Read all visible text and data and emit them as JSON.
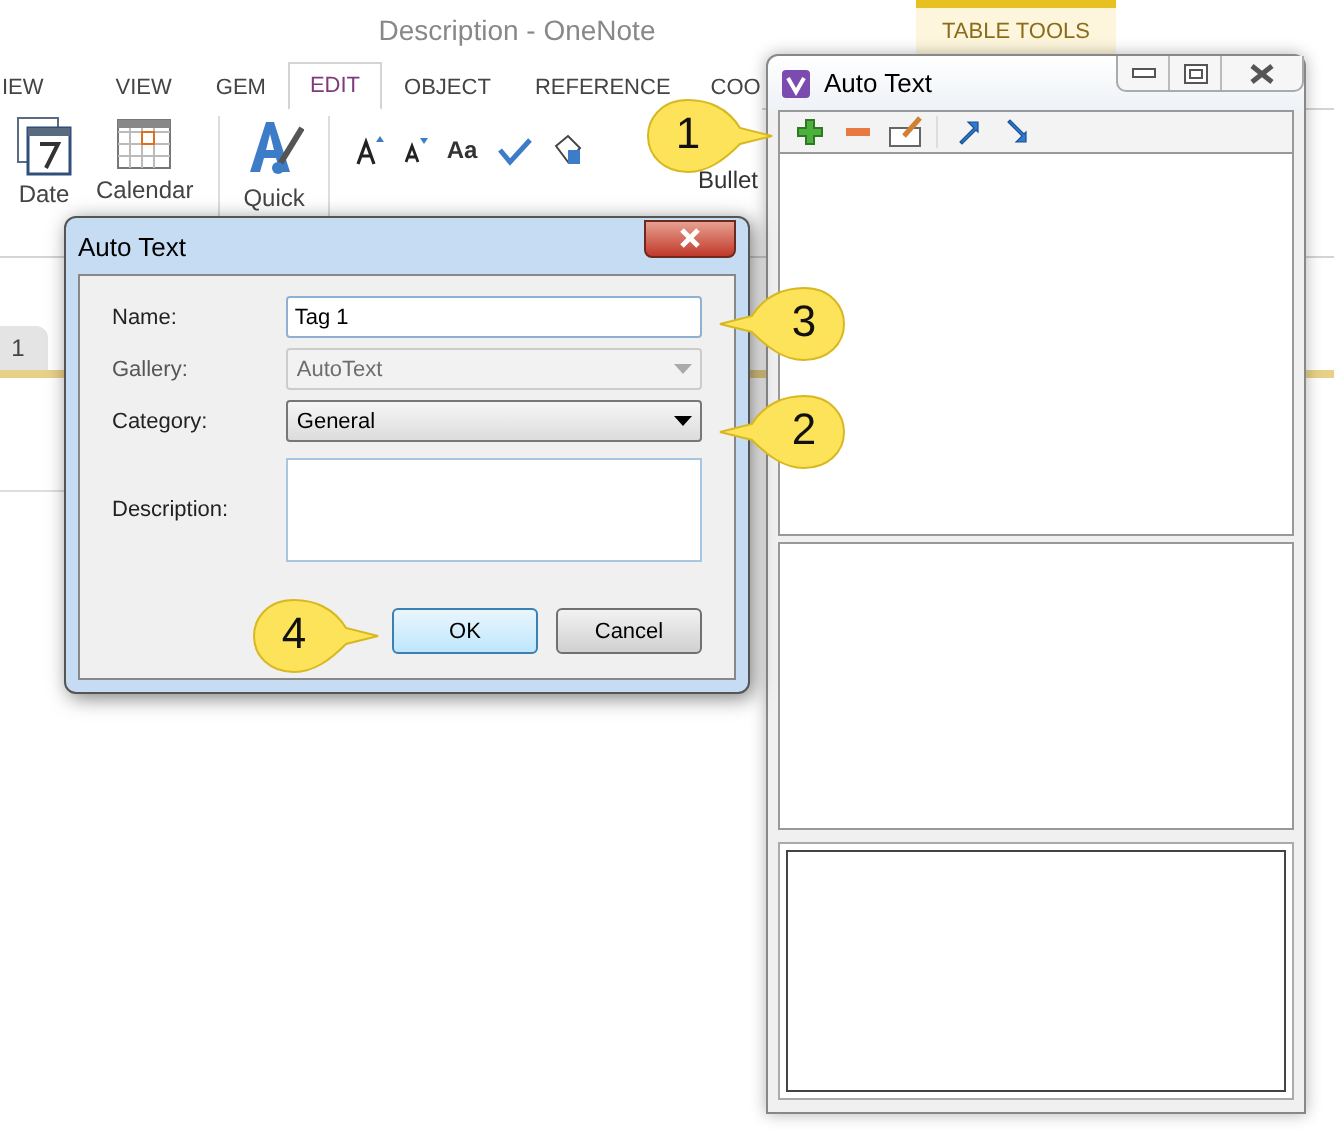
{
  "app": {
    "title": "Description - OneNote",
    "context_tab": "TABLE TOOLS",
    "tabs": [
      {
        "label": "IEW",
        "selected": false
      },
      {
        "label": "VIEW",
        "selected": false
      },
      {
        "label": "GEM",
        "selected": false
      },
      {
        "label": "EDIT",
        "selected": true
      },
      {
        "label": "OBJECT",
        "selected": false
      },
      {
        "label": "REFERENCE",
        "selected": false
      },
      {
        "label": "COO",
        "selected": false
      }
    ],
    "ribbon": [
      {
        "kind": "date",
        "label": "Date"
      },
      {
        "kind": "calendar",
        "label": "Calendar"
      },
      {
        "kind": "quick",
        "label": "Quick"
      }
    ],
    "font_case": "Aa",
    "bullet": "Bullet",
    "section_tab": "1"
  },
  "panel": {
    "title": "Auto Text"
  },
  "dialog": {
    "title": "Auto Text",
    "fields": [
      {
        "kind": "text",
        "label": "Name:",
        "value": "Tag 1"
      },
      {
        "kind": "select",
        "label": "Gallery:",
        "value": "AutoText",
        "disabled": true
      },
      {
        "kind": "select",
        "label": "Category:",
        "value": "General",
        "disabled": false
      },
      {
        "kind": "area",
        "label": "Description:"
      }
    ],
    "buttons": [
      {
        "label": "OK",
        "default": true
      },
      {
        "label": "Cancel",
        "default": false
      }
    ]
  },
  "callouts": [
    {
      "number": "1"
    },
    {
      "number": "3"
    },
    {
      "number": "2"
    },
    {
      "number": "4"
    }
  ]
}
